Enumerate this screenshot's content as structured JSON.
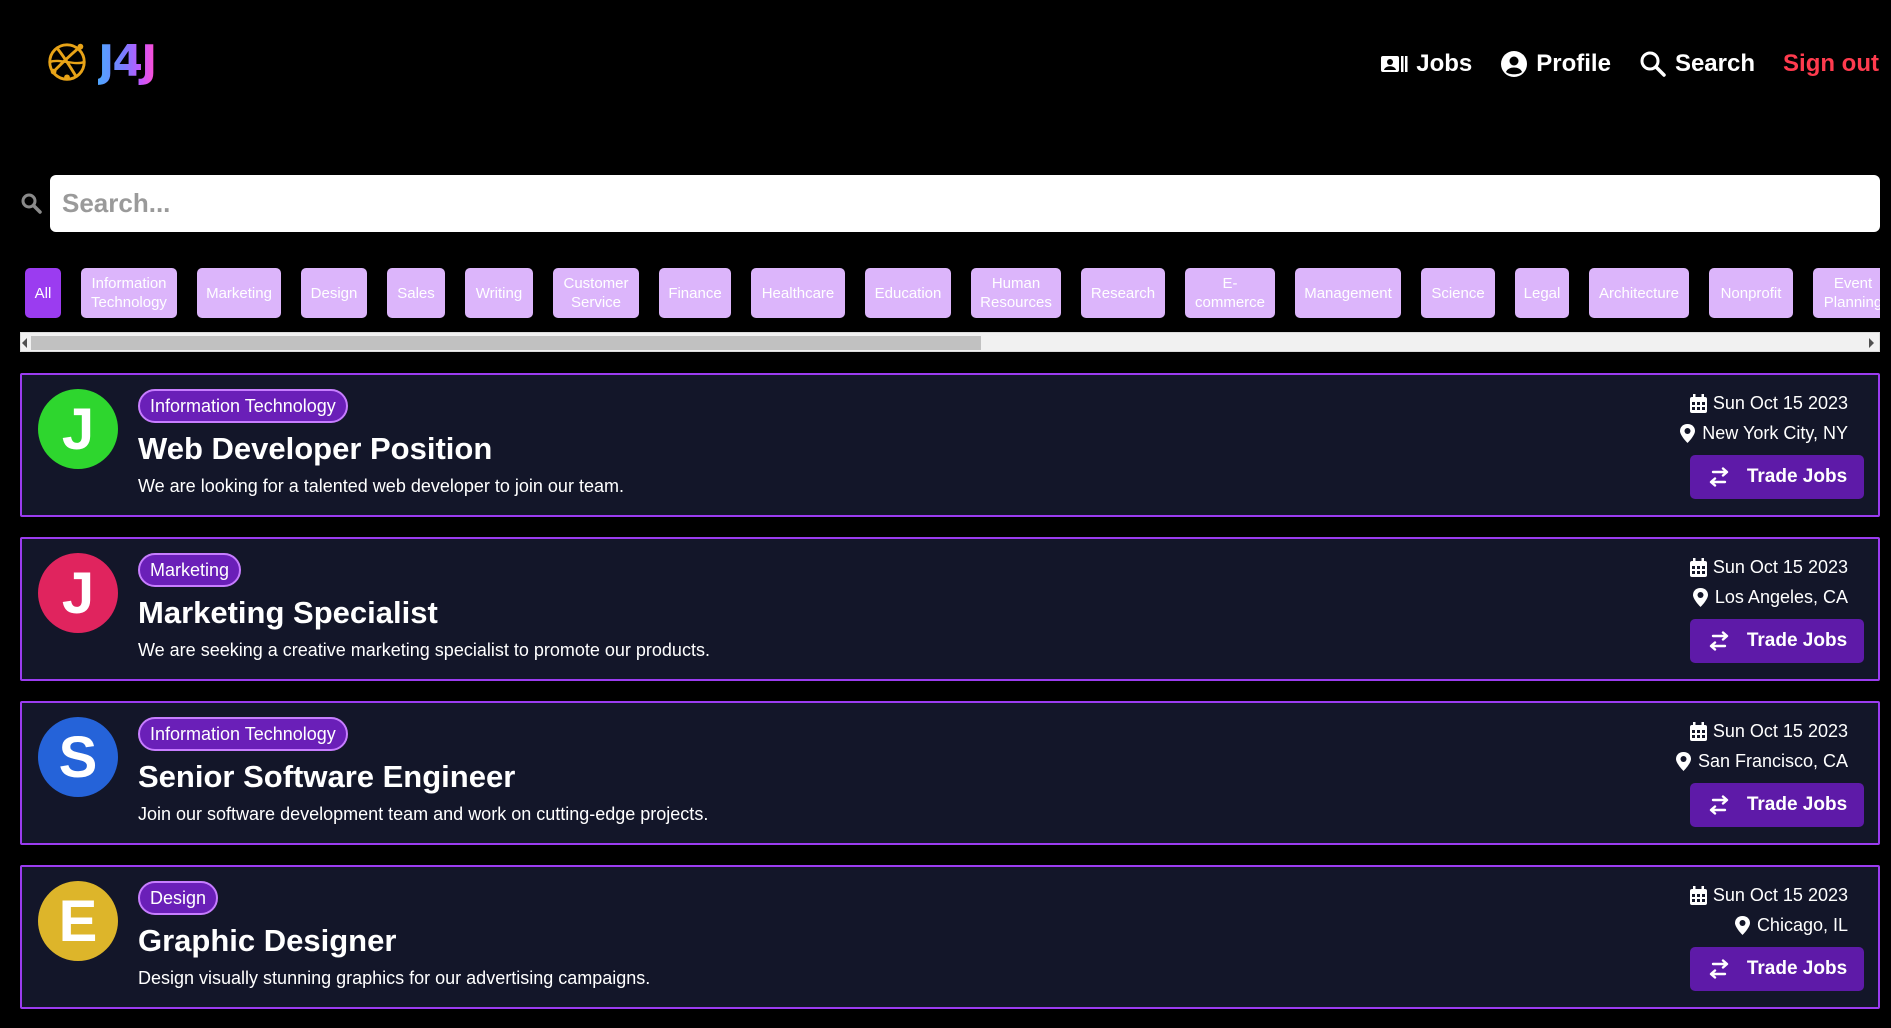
{
  "brand": {
    "name": "J4J"
  },
  "nav": {
    "jobs": "Jobs",
    "profile": "Profile",
    "search": "Search",
    "signout": "Sign out"
  },
  "search": {
    "placeholder": "Search..."
  },
  "categories": [
    {
      "label": "All",
      "active": true
    },
    {
      "label": "Information Technology",
      "active": false
    },
    {
      "label": "Marketing",
      "active": false
    },
    {
      "label": "Design",
      "active": false
    },
    {
      "label": "Sales",
      "active": false
    },
    {
      "label": "Writing",
      "active": false
    },
    {
      "label": "Customer Service",
      "active": false
    },
    {
      "label": "Finance",
      "active": false
    },
    {
      "label": "Healthcare",
      "active": false
    },
    {
      "label": "Education",
      "active": false
    },
    {
      "label": "Human Resources",
      "active": false
    },
    {
      "label": "Research",
      "active": false
    },
    {
      "label": "E-commerce",
      "active": false
    },
    {
      "label": "Management",
      "active": false
    },
    {
      "label": "Science",
      "active": false
    },
    {
      "label": "Legal",
      "active": false
    },
    {
      "label": "Architecture",
      "active": false
    },
    {
      "label": "Nonprofit",
      "active": false
    },
    {
      "label": "Event Planning",
      "active": false
    }
  ],
  "colors": {
    "accent": "#9b3cf0",
    "chip": "#dcb5fb",
    "signout": "#ff3b4e",
    "card_bg": "#131629",
    "button": "#5e1aa8"
  },
  "jobs": [
    {
      "initial": "J",
      "avatar_color": "#2ed62e",
      "category": "Information Technology",
      "title": "Web Developer Position",
      "description": "We are looking for a talented web developer to join our team.",
      "date": "Sun Oct 15 2023",
      "location": "New York City, NY",
      "action": "Trade Jobs"
    },
    {
      "initial": "J",
      "avatar_color": "#e0245e",
      "category": "Marketing",
      "title": "Marketing Specialist",
      "description": "We are seeking a creative marketing specialist to promote our products.",
      "date": "Sun Oct 15 2023",
      "location": "Los Angeles, CA",
      "action": "Trade Jobs"
    },
    {
      "initial": "S",
      "avatar_color": "#2563d9",
      "category": "Information Technology",
      "title": "Senior Software Engineer",
      "description": "Join our software development team and work on cutting-edge projects.",
      "date": "Sun Oct 15 2023",
      "location": "San Francisco, CA",
      "action": "Trade Jobs"
    },
    {
      "initial": "E",
      "avatar_color": "#ddb52a",
      "category": "Design",
      "title": "Graphic Designer",
      "description": "Design visually stunning graphics for our advertising campaigns.",
      "date": "Sun Oct 15 2023",
      "location": "Chicago, IL",
      "action": "Trade Jobs"
    }
  ]
}
